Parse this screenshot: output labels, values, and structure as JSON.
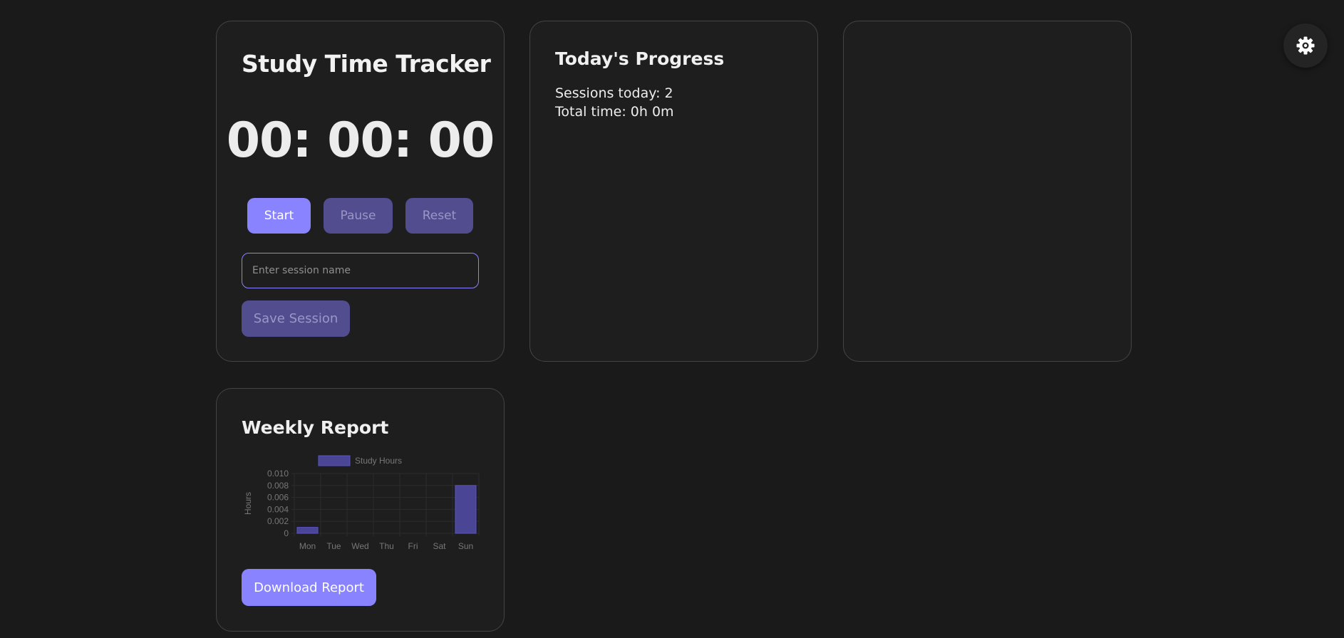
{
  "tracker": {
    "title": "Study Time Tracker",
    "timer": "00: 00: 00",
    "start_label": "Start",
    "pause_label": "Pause",
    "reset_label": "Reset",
    "session_placeholder": "Enter session name",
    "session_value": "",
    "save_label": "Save Session"
  },
  "progress": {
    "title": "Today's Progress",
    "sessions_today": "Sessions today: 2",
    "total_time": "Total time: 0h 0m"
  },
  "weekly": {
    "title": "Weekly Report",
    "download_label": "Download Report"
  },
  "settings": {
    "icon": "gear-icon"
  },
  "colors": {
    "background": "#1a1a1a",
    "card": "#1e1e1e",
    "accent": "#8a83ff",
    "accent_disabled": "#524d8f",
    "bar_fill": "#4a4594",
    "bar_border": "#5b52c9"
  },
  "chart_data": {
    "type": "bar",
    "categories": [
      "Mon",
      "Tue",
      "Wed",
      "Thu",
      "Fri",
      "Sat",
      "Sun"
    ],
    "series": [
      {
        "name": "Study Hours",
        "values": [
          0.001,
          0,
          0,
          0,
          0,
          0,
          0.008
        ]
      }
    ],
    "ylabel": "Hours",
    "xlabel": "",
    "ylim": [
      0,
      0.01
    ],
    "yticks": [
      0,
      0.002,
      0.004,
      0.006,
      0.008,
      0.01
    ],
    "ytick_labels": [
      "0",
      "0.002",
      "0.004",
      "0.006",
      "0.008",
      "0.010"
    ],
    "grid": true,
    "legend": "top"
  }
}
